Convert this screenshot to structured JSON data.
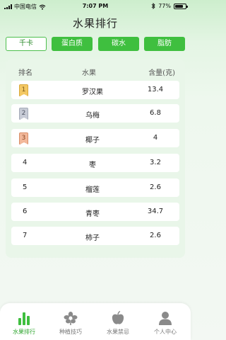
{
  "status_bar": {
    "carrier": "中国电信",
    "time": "7:07 PM",
    "battery": "77%",
    "battery_level": 0.77
  },
  "page": {
    "title": "水果排行"
  },
  "tabs": [
    {
      "label": "千卡",
      "active": true
    },
    {
      "label": "蛋白质",
      "active": false
    },
    {
      "label": "碳水",
      "active": false
    },
    {
      "label": "脂肪",
      "active": false
    }
  ],
  "table": {
    "headers": {
      "rank": "排名",
      "fruit": "水果",
      "content": "含量(克)"
    },
    "rows": [
      {
        "rank": "1",
        "fruit": "罗汉果",
        "amount": "13.4",
        "medal": "gold"
      },
      {
        "rank": "2",
        "fruit": "乌梅",
        "amount": "6.8",
        "medal": "silver"
      },
      {
        "rank": "3",
        "fruit": "椰子",
        "amount": "4",
        "medal": "bronze"
      },
      {
        "rank": "4",
        "fruit": "枣",
        "amount": "3.2",
        "medal": ""
      },
      {
        "rank": "5",
        "fruit": "榴莲",
        "amount": "2.6",
        "medal": ""
      },
      {
        "rank": "6",
        "fruit": "青枣",
        "amount": "34.7",
        "medal": ""
      },
      {
        "rank": "7",
        "fruit": "柿子",
        "amount": "2.6",
        "medal": ""
      }
    ]
  },
  "tabbar": {
    "items": [
      {
        "label": "水果排行",
        "icon": "bar-chart-icon",
        "active": true
      },
      {
        "label": "种植技巧",
        "icon": "flower-icon",
        "active": false
      },
      {
        "label": "水果禁忌",
        "icon": "apple-icon",
        "active": false
      },
      {
        "label": "个人中心",
        "icon": "person-icon",
        "active": false
      }
    ]
  },
  "colors": {
    "accent": "#3fbf3f",
    "accent_dark": "#2fa52f",
    "inactive_icon": "#8a8a8a"
  }
}
